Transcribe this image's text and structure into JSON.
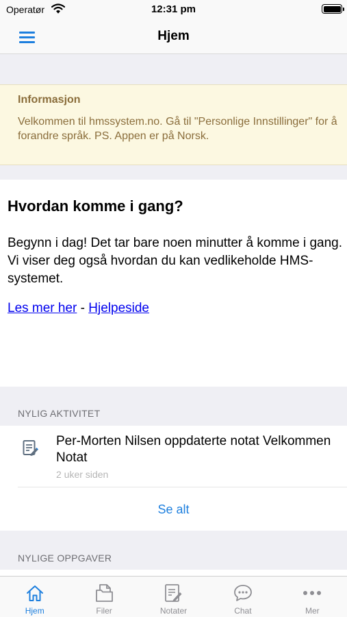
{
  "status_bar": {
    "carrier": "Operatør",
    "time": "12:31 pm",
    "wifi_icon": "wifi-icon",
    "battery_icon": "battery-icon"
  },
  "nav": {
    "title": "Hjem",
    "menu_icon": "hamburger-menu-icon"
  },
  "info": {
    "title": "Informasjon",
    "text": "Velkommen til hmssystem.no. Gå til \"Personlige Innstillinger\" for å forandre språk. PS. Appen er på Norsk."
  },
  "getting_started": {
    "title": "Hvordan komme i gang?",
    "body": "Begynn i dag! Det tar bare noen minutter å komme i gang. Vi viser deg også hvordan du kan vedlikeholde HMS-systemet.",
    "link_read_more": "Les mer her",
    "separator": "-",
    "link_help": "Hjelpeside"
  },
  "recent_activity": {
    "header": "NYLIG AKTIVITET",
    "items": [
      {
        "icon": "edit-note-icon",
        "title": "Per-Morten Nilsen oppdaterte notat Velkommen Notat",
        "time": "2 uker siden"
      }
    ],
    "see_all": "Se alt"
  },
  "recent_tasks": {
    "header": "NYLIGE OPPGAVER"
  },
  "tabs": [
    {
      "label": "Hjem",
      "icon": "home-icon",
      "active": true
    },
    {
      "label": "Filer",
      "icon": "files-icon",
      "active": false
    },
    {
      "label": "Notater",
      "icon": "notes-icon",
      "active": false
    },
    {
      "label": "Chat",
      "icon": "chat-icon",
      "active": false
    },
    {
      "label": "Mer",
      "icon": "more-icon",
      "active": false
    }
  ],
  "colors": {
    "accent": "#1d7fde",
    "info_background": "#fcf8e1",
    "info_text": "#8a6d3b",
    "link": "#0000ee",
    "background": "#efeff4"
  }
}
